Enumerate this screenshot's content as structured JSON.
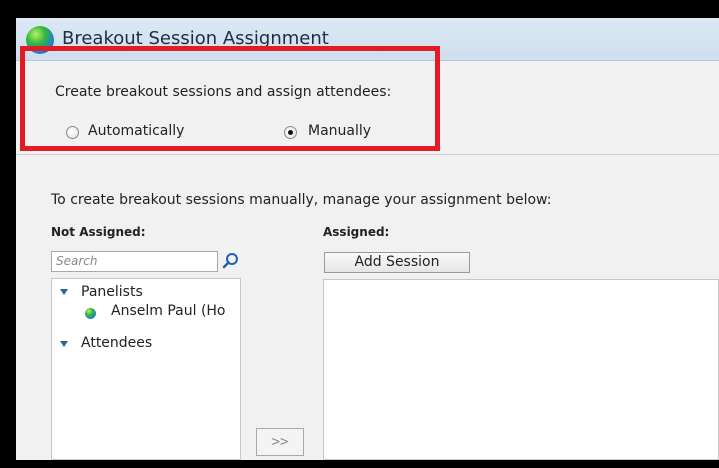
{
  "window": {
    "title": "Breakout Session Assignment"
  },
  "creation": {
    "prompt": "Create breakout sessions and assign attendees:",
    "options": [
      {
        "label": "Automatically",
        "selected": false
      },
      {
        "label": "Manually",
        "selected": true
      }
    ]
  },
  "manual": {
    "instruction": "To create breakout sessions manually, manage your assignment below:",
    "not_assigned_label": "Not Assigned:",
    "assigned_label": "Assigned:",
    "search_placeholder": "Search",
    "add_session_label": "Add Session",
    "move_right_label": ">>",
    "tree": [
      {
        "group": "Panelists",
        "members": [
          "Anselm Paul (Ho"
        ]
      },
      {
        "group": "Attendees",
        "members": []
      }
    ]
  },
  "highlight_color": "#e31c23"
}
